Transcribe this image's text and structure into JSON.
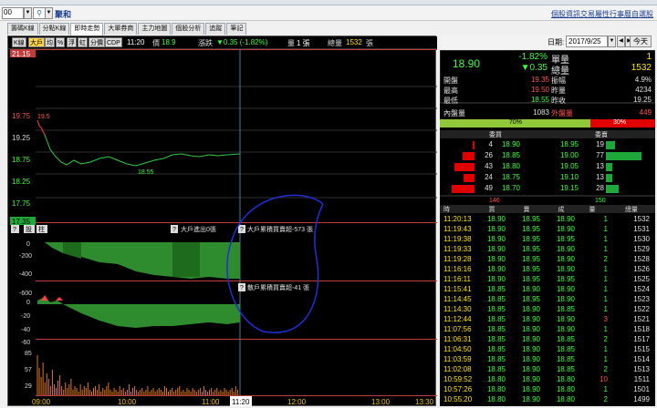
{
  "toolbar": {
    "stock_input_value": "00",
    "stock_name": "聚和",
    "links": [
      "個股資訊",
      "交易屬性",
      "行事曆",
      "自選股"
    ]
  },
  "tabs": [
    "籌碼K線",
    "分點K線",
    "即時走勢",
    "大單券商",
    "主力地圖",
    "個股分析",
    "追蹤",
    "筆記"
  ],
  "chart_header": {
    "buttons": [
      "K線",
      "大戶",
      "均",
      "%",
      "浮",
      "虹",
      "分價",
      "CDP"
    ],
    "time": "11:20",
    "price_label": "價",
    "price": "18.9",
    "change_label": "漲跌",
    "change": "▼0.35 (-1.82%)",
    "volume_label": "量",
    "volume": "1 張",
    "total_label": "總量",
    "total": "1532",
    "total_unit": "張"
  },
  "chart_labels": {
    "price_axis": [
      "21.15",
      "19.75",
      "19.25",
      "18.75",
      "18.25",
      "17.75",
      "17.35"
    ],
    "first_marker": "19.5",
    "low_marker": "18.55",
    "big_axis": [
      "0",
      "-200",
      "-400",
      "-600"
    ],
    "small_axis": [
      "0",
      "-20",
      "-40",
      "-60"
    ],
    "vol_axis": [
      "85",
      "57",
      "29"
    ],
    "time_axis": [
      "09:00",
      "10:00",
      "11:00",
      "11:20",
      "12:00",
      "13:00",
      "13:30"
    ],
    "sub_btns": [
      "?",
      "設",
      "柱"
    ],
    "big_label": "大戶進出0張",
    "big_accum": "大戶累積買賣超-573 張",
    "small_accum": "散戶累積買賣超-41 張",
    "q": "?"
  },
  "right_panel": {
    "date_label": "日期:",
    "date": "2017/9/25",
    "today_btn": "今天",
    "nav_prev": "◀",
    "nav_next": "▶",
    "nav_dd": "▼",
    "price": "18.90",
    "pct": "-1.82%",
    "chg": "▼0.35",
    "single_label": "單量",
    "single": "1",
    "total_label": "總量",
    "total": "1532",
    "stats": [
      {
        "label": "開盤",
        "value": "19.35",
        "label2": "振幅",
        "value2": "4.9%"
      },
      {
        "label": "最高",
        "value": "19.50",
        "label2": "昨量",
        "value2": "4234"
      },
      {
        "label": "最低",
        "value": "18.55",
        "label2": "昨收",
        "value2": "19.25"
      }
    ],
    "inner_label": "內盤量",
    "inner": "1083",
    "outer_label": "外盤量",
    "outer": "449",
    "inner_pct": "70%",
    "outer_pct": "30%",
    "book_headers": [
      "委買",
      "委賣"
    ],
    "book": [
      {
        "bq": "4",
        "bp": "18.90",
        "ap": "18.95",
        "aq": "19"
      },
      {
        "bq": "26",
        "bp": "18.85",
        "ap": "19.00",
        "aq": "77"
      },
      {
        "bq": "43",
        "bp": "18.80",
        "ap": "19.05",
        "aq": "13"
      },
      {
        "bq": "24",
        "bp": "18.75",
        "ap": "19.10",
        "aq": "13"
      },
      {
        "bq": "49",
        "bp": "18.70",
        "ap": "19.15",
        "aq": "28"
      }
    ],
    "book_totals": [
      "146",
      "150"
    ],
    "ticks_headers": [
      "時",
      "買",
      "賣",
      "成",
      "量",
      "總量"
    ],
    "ticks": [
      [
        "11:20:13",
        "18.90",
        "18.95",
        "18.90",
        "1",
        "1532"
      ],
      [
        "11:19:43",
        "18.90",
        "18.95",
        "18.90",
        "1",
        "1531"
      ],
      [
        "11:19:38",
        "18.90",
        "18.95",
        "18.95",
        "1",
        "1530"
      ],
      [
        "11:19:33",
        "18.90",
        "18.95",
        "18.90",
        "1",
        "1529"
      ],
      [
        "11:19:28",
        "18.90",
        "18.95",
        "18.90",
        "2",
        "1528"
      ],
      [
        "11:16:16",
        "18.90",
        "18.95",
        "18.90",
        "1",
        "1526"
      ],
      [
        "11:16:11",
        "18.90",
        "18.95",
        "18.95",
        "1",
        "1525"
      ],
      [
        "11:15:41",
        "18.85",
        "18.90",
        "18.90",
        "1",
        "1524"
      ],
      [
        "11:14:45",
        "18.85",
        "18.95",
        "18.90",
        "1",
        "1523"
      ],
      [
        "11:14:30",
        "18.85",
        "18.90",
        "18.85",
        "1",
        "1522"
      ],
      [
        "11:12:44",
        "18.85",
        "18.90",
        "18.90",
        "3",
        "1521"
      ],
      [
        "11:07:56",
        "18.85",
        "18.90",
        "18.90",
        "1",
        "1518"
      ],
      [
        "11:06:31",
        "18.85",
        "18.90",
        "18.85",
        "2",
        "1517"
      ],
      [
        "11:04:50",
        "18.85",
        "18.90",
        "18.85",
        "1",
        "1515"
      ],
      [
        "11:03:59",
        "18.85",
        "18.90",
        "18.85",
        "1",
        "1514"
      ],
      [
        "11:02:08",
        "18.85",
        "18.90",
        "18.85",
        "2",
        "1513"
      ],
      [
        "10:59:52",
        "18.80",
        "18.90",
        "18.80",
        "10",
        "1511"
      ],
      [
        "10:57:26",
        "18.80",
        "18.90",
        "18.80",
        "1",
        "1501"
      ],
      [
        "10:55:20",
        "18.80",
        "18.90",
        "18.80",
        "2",
        "1499"
      ]
    ]
  }
}
